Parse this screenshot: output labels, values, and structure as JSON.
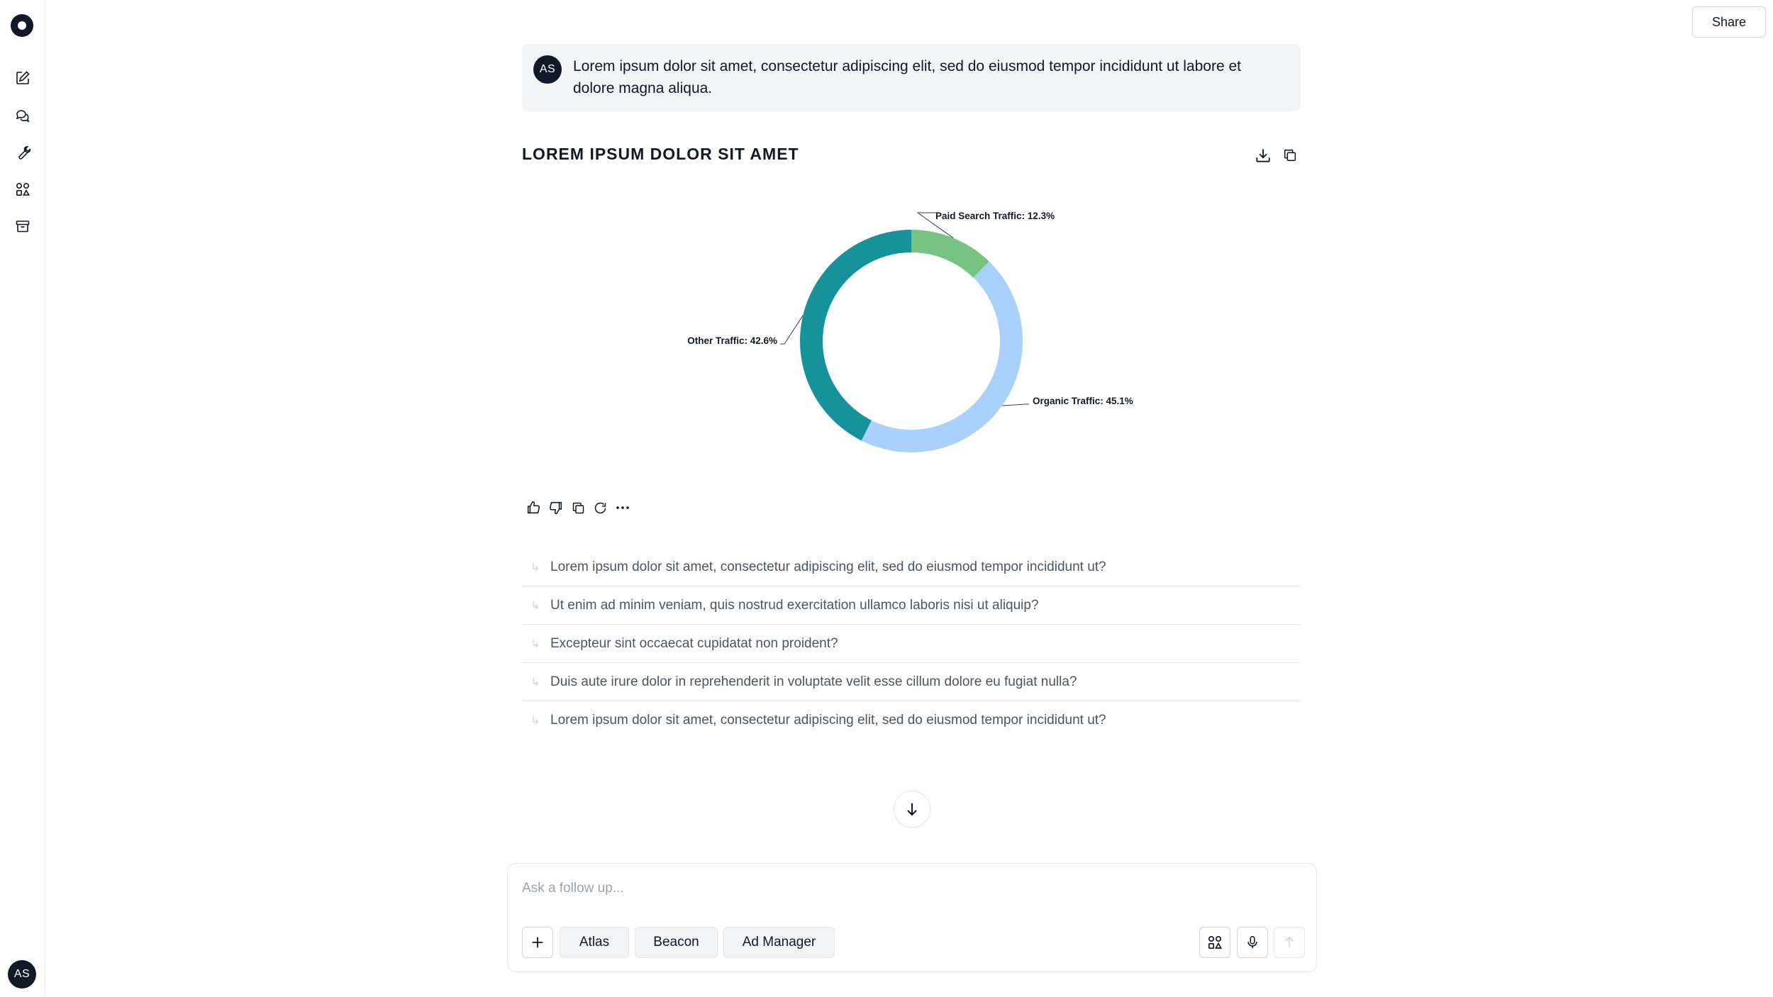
{
  "header": {
    "share_label": "Share"
  },
  "sidebar": {
    "icons": [
      "edit-icon",
      "chat-icon",
      "wrench-icon",
      "apps-icon",
      "archive-icon"
    ],
    "avatar_initials": "AS"
  },
  "user_message": {
    "initials": "AS",
    "text": "Lorem ipsum dolor sit amet, consectetur adipiscing elit, sed do eiusmod tempor incididunt ut labore et dolore magna aliqua."
  },
  "chart_data": {
    "type": "pie",
    "title": "LOREM IPSUM DOLOR SIT AMET",
    "donut": true,
    "slices": [
      {
        "label": "Paid Search Traffic",
        "value": 12.3,
        "color": "#77c482"
      },
      {
        "label": "Organic Traffic",
        "value": 45.1,
        "color": "#a9d1fb"
      },
      {
        "label": "Other Traffic",
        "value": 42.6,
        "color": "#16929a"
      }
    ],
    "slice_labels": [
      "Paid Search Traffic: 12.3%",
      "Organic Traffic: 45.1%",
      "Other Traffic: 42.6%"
    ]
  },
  "suggestions": [
    "Lorem ipsum dolor sit amet, consectetur adipiscing elit, sed do eiusmod tempor incididunt ut?",
    "Ut enim ad minim veniam, quis nostrud exercitation ullamco laboris nisi ut aliquip?",
    "Excepteur sint occaecat cupidatat non proident?",
    "Duis aute irure dolor in reprehenderit in voluptate velit esse cillum dolore eu fugiat nulla?",
    "Lorem ipsum dolor sit amet, consectetur adipiscing elit, sed do eiusmod tempor incididunt ut?"
  ],
  "composer": {
    "placeholder": "Ask a follow up...",
    "chips": [
      "Atlas",
      "Beacon",
      "Ad Manager"
    ]
  }
}
